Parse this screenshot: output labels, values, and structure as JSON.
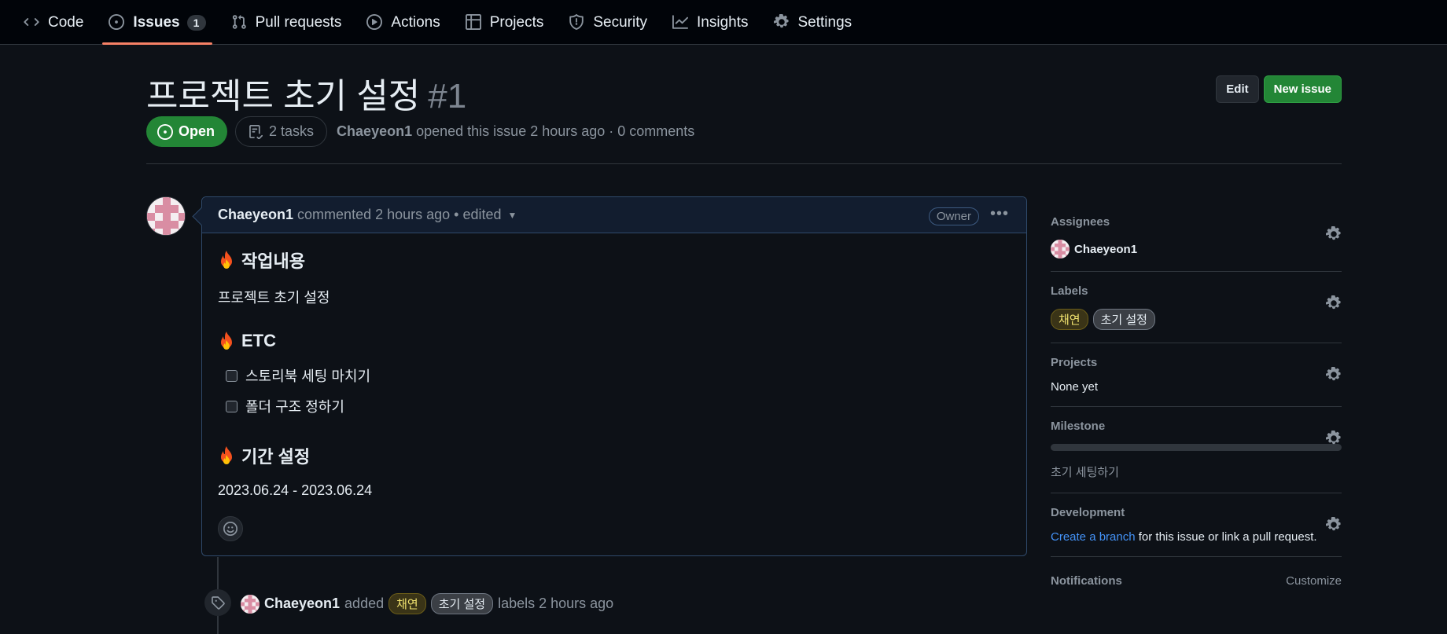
{
  "tabs": [
    {
      "label": "Code",
      "icon": "code-icon"
    },
    {
      "label": "Issues",
      "icon": "issue-opened-icon",
      "count": "1",
      "active": true
    },
    {
      "label": "Pull requests",
      "icon": "git-pull-request-icon"
    },
    {
      "label": "Actions",
      "icon": "play-icon"
    },
    {
      "label": "Projects",
      "icon": "table-icon"
    },
    {
      "label": "Security",
      "icon": "shield-icon"
    },
    {
      "label": "Insights",
      "icon": "graph-icon"
    },
    {
      "label": "Settings",
      "icon": "gear-icon"
    }
  ],
  "issue": {
    "title": "프로젝트 초기 설정",
    "number": "#1",
    "state": "Open",
    "tasks": "2 tasks",
    "author": "Chaeyeon1",
    "opened_text": "opened this issue 2 hours ago · 0 comments"
  },
  "header_actions": {
    "edit": "Edit",
    "new_issue": "New issue"
  },
  "comment": {
    "author": "Chaeyeon1",
    "meta": "commented 2 hours ago • edited",
    "badge": "Owner",
    "sections": {
      "work_heading": "작업내용",
      "work_text": "프로젝트 초기 설정",
      "etc_heading": "ETC",
      "task1": "스토리북 세팅 마치기",
      "task2": "폴더 구조 정하기",
      "period_heading": "기간 설정",
      "period_text": "2023.06.24 - 2023.06.24"
    }
  },
  "timeline": {
    "author": "Chaeyeon1",
    "added": "added",
    "labels_suffix": "labels 2 hours ago"
  },
  "labels": [
    {
      "name": "채연",
      "color": "#f0e26f"
    },
    {
      "name": "초기 설정",
      "color": "#6e7681"
    }
  ],
  "sidebar": {
    "assignees_title": "Assignees",
    "assignee": "Chaeyeon1",
    "labels_title": "Labels",
    "projects_title": "Projects",
    "projects_value": "None yet",
    "milestone_title": "Milestone",
    "milestone_progress": 0,
    "milestone_name": "초기 세팅하기",
    "development_title": "Development",
    "dev_link": "Create a branch",
    "dev_text": "for this issue or link a pull request.",
    "notifications_title": "Notifications",
    "customize": "Customize"
  },
  "colors": {
    "accent": "#f78166",
    "open": "#238636",
    "link": "#4493f8"
  }
}
